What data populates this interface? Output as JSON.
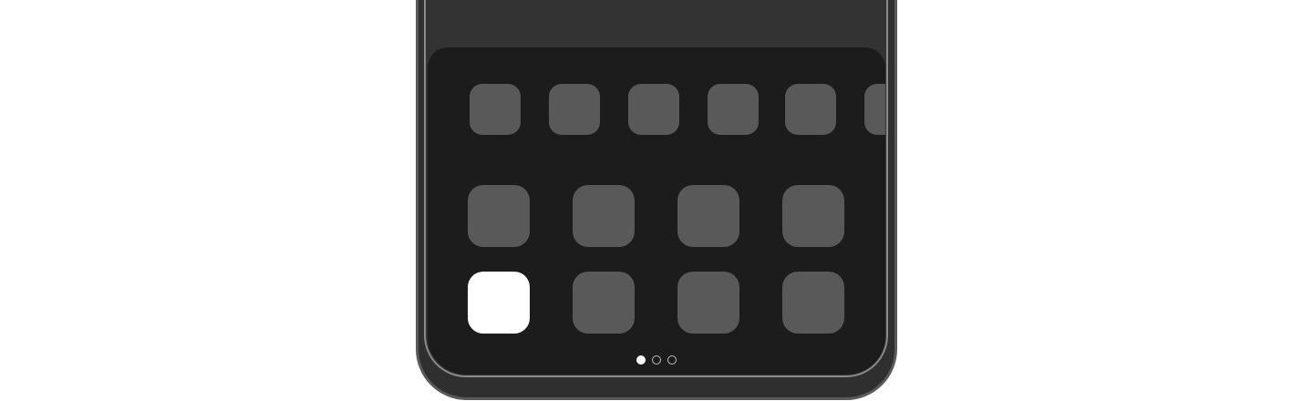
{
  "home_screen": {
    "top_row_apps": [
      {
        "icon": "app-placeholder-icon",
        "color": "#595959"
      },
      {
        "icon": "app-placeholder-icon",
        "color": "#595959"
      },
      {
        "icon": "app-placeholder-icon",
        "color": "#595959"
      },
      {
        "icon": "app-placeholder-icon",
        "color": "#595959"
      },
      {
        "icon": "app-placeholder-icon",
        "color": "#595959"
      },
      {
        "icon": "app-placeholder-icon",
        "color": "#595959"
      }
    ],
    "grid_apps": [
      {
        "icon": "app-placeholder-icon",
        "color": "#595959"
      },
      {
        "icon": "app-placeholder-icon",
        "color": "#595959"
      },
      {
        "icon": "app-placeholder-icon",
        "color": "#595959"
      },
      {
        "icon": "app-placeholder-icon",
        "color": "#595959"
      },
      {
        "icon": "app-placeholder-icon",
        "color": "#ffffff",
        "highlighted": true
      },
      {
        "icon": "app-placeholder-icon",
        "color": "#595959"
      },
      {
        "icon": "app-placeholder-icon",
        "color": "#595959"
      },
      {
        "icon": "app-placeholder-icon",
        "color": "#595959"
      }
    ],
    "page_indicator": {
      "pages": 3,
      "current": 1
    }
  },
  "colors": {
    "screen_background": "#1c1c1c",
    "icon_placeholder": "#595959",
    "icon_highlight": "#ffffff",
    "device_frame": "#2f2f2f"
  }
}
